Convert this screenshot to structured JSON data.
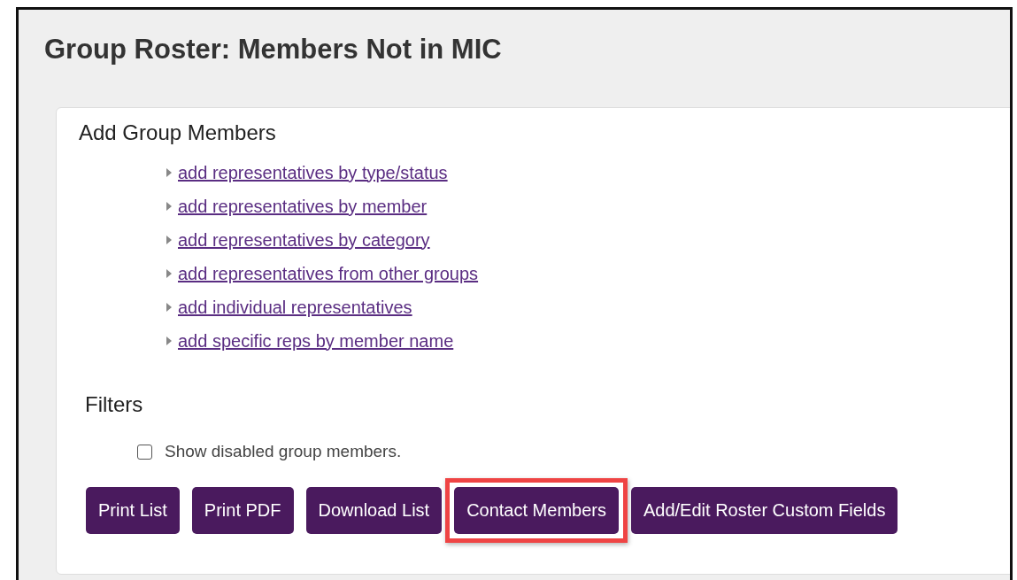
{
  "page": {
    "title": "Group Roster: Members Not in MIC"
  },
  "add_section": {
    "heading": "Add Group Members",
    "links": [
      "add representatives by type/status",
      "add representatives by member",
      "add representatives by category",
      "add representatives from other groups",
      "add individual representatives",
      "add specific reps by member name"
    ]
  },
  "filters": {
    "heading": "Filters",
    "options": [
      {
        "label": "Show disabled group members.",
        "checked": false
      }
    ]
  },
  "buttons": [
    {
      "label": "Print List",
      "highlighted": false
    },
    {
      "label": "Print PDF",
      "highlighted": false
    },
    {
      "label": "Download List",
      "highlighted": false
    },
    {
      "label": "Contact Members",
      "highlighted": true
    },
    {
      "label": "Add/Edit Roster Custom Fields",
      "highlighted": false
    }
  ]
}
